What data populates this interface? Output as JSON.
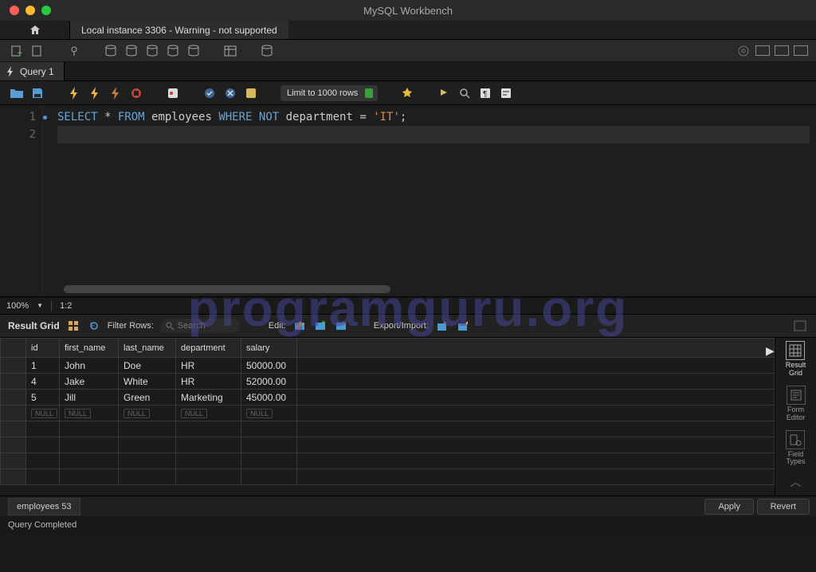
{
  "titlebar": {
    "title": "MySQL Workbench"
  },
  "tabs": {
    "connection_tab": "Local instance 3306 - Warning - not supported"
  },
  "query": {
    "tab_label": "Query 1",
    "limit_label": "Limit to 1000 rows",
    "sql_line1": {
      "kw1": "SELECT",
      "star": " * ",
      "kw2": "FROM",
      "tbl": " employees ",
      "kw3": "WHERE NOT",
      "col": " department = ",
      "str": "'IT'",
      "end": ";"
    }
  },
  "editor_status": {
    "zoom": "100%",
    "pos": "1:2"
  },
  "results_toolbar": {
    "grid_label": "Result Grid",
    "filter_label": "Filter Rows:",
    "search_placeholder": "Search",
    "edit_label": "Edit:",
    "export_label": "Export/Import:"
  },
  "grid": {
    "headers": [
      "id",
      "first_name",
      "last_name",
      "department",
      "salary"
    ],
    "rows": [
      {
        "id": "1",
        "first_name": "John",
        "last_name": "Doe",
        "department": "HR",
        "salary": "50000.00"
      },
      {
        "id": "4",
        "first_name": "Jake",
        "last_name": "White",
        "department": "HR",
        "salary": "52000.00"
      },
      {
        "id": "5",
        "first_name": "Jill",
        "last_name": "Green",
        "department": "Marketing",
        "salary": "45000.00"
      }
    ],
    "null_label": "NULL"
  },
  "right_panel": {
    "result_grid": "Result\nGrid",
    "form_editor": "Form\nEditor",
    "field_types": "Field\nTypes"
  },
  "bottom": {
    "sheet_tab": "employees 53",
    "apply": "Apply",
    "revert": "Revert"
  },
  "status": {
    "text": "Query Completed"
  },
  "watermark": "programguru.org"
}
